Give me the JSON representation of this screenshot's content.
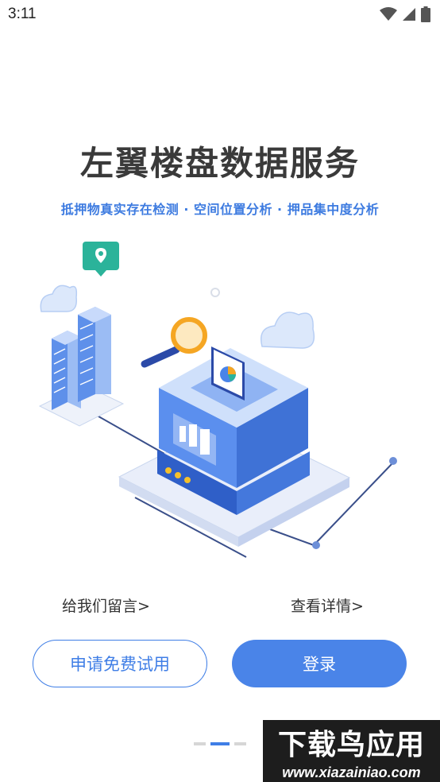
{
  "status_bar": {
    "time": "3:11",
    "icons": [
      "wifi-icon",
      "signal-icon",
      "battery-icon"
    ]
  },
  "hero": {
    "title": "左翼楼盘数据服务",
    "subtitle": "抵押物真实存在检测 · 空间位置分析 · 押品集中度分析"
  },
  "links": {
    "leave_message": "给我们留言>",
    "view_details": "查看详情>"
  },
  "buttons": {
    "trial": "申请免费试用",
    "login": "登录"
  },
  "pager": {
    "count": 3,
    "active_index": 1
  },
  "watermark": {
    "name": "下载鸟应用",
    "url": "www.xiazainiao.com"
  },
  "colors": {
    "accent": "#4a84e8",
    "subtitle": "#3d7be0",
    "title": "#3a3a3a",
    "pin": "#2bb39a",
    "magnifier": "#f5a623"
  }
}
